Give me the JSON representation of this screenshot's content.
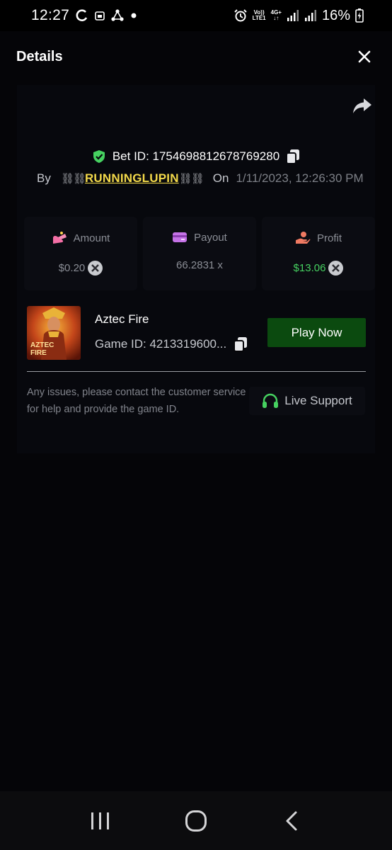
{
  "status_bar": {
    "time": "12:27",
    "network_top": "Vo))",
    "network_bottom": "LTE1",
    "network_type": "4G+",
    "battery": "16%"
  },
  "header": {
    "title": "Details"
  },
  "bet": {
    "id_label": "Bet ID: 1754698812678769280",
    "by_label": "By",
    "chain_left": "⛓⛓",
    "username": "RUNNINGLUPIN",
    "chain_right": "⛓⛓",
    "on_label": "On",
    "date": "1/11/2023, 12:26:30 PM"
  },
  "stats": {
    "amount_label": "Amount",
    "amount_value": "$0.20",
    "payout_label": "Payout",
    "payout_value": "66.2831 x",
    "profit_label": "Profit",
    "profit_value": "$13.06"
  },
  "game": {
    "name": "Aztec Fire",
    "id_label": "Game ID: 4213319600...",
    "thumb_line1": "AZTEC",
    "thumb_line2": "FIRE",
    "play_label": "Play Now"
  },
  "support": {
    "help_text": "Any issues, please contact the customer service for help and provide the game ID.",
    "button_label": "Live Support"
  },
  "colors": {
    "accent_green": "#46d160",
    "play_button": "#0b4a0f",
    "username_yellow": "#f3d94a"
  }
}
